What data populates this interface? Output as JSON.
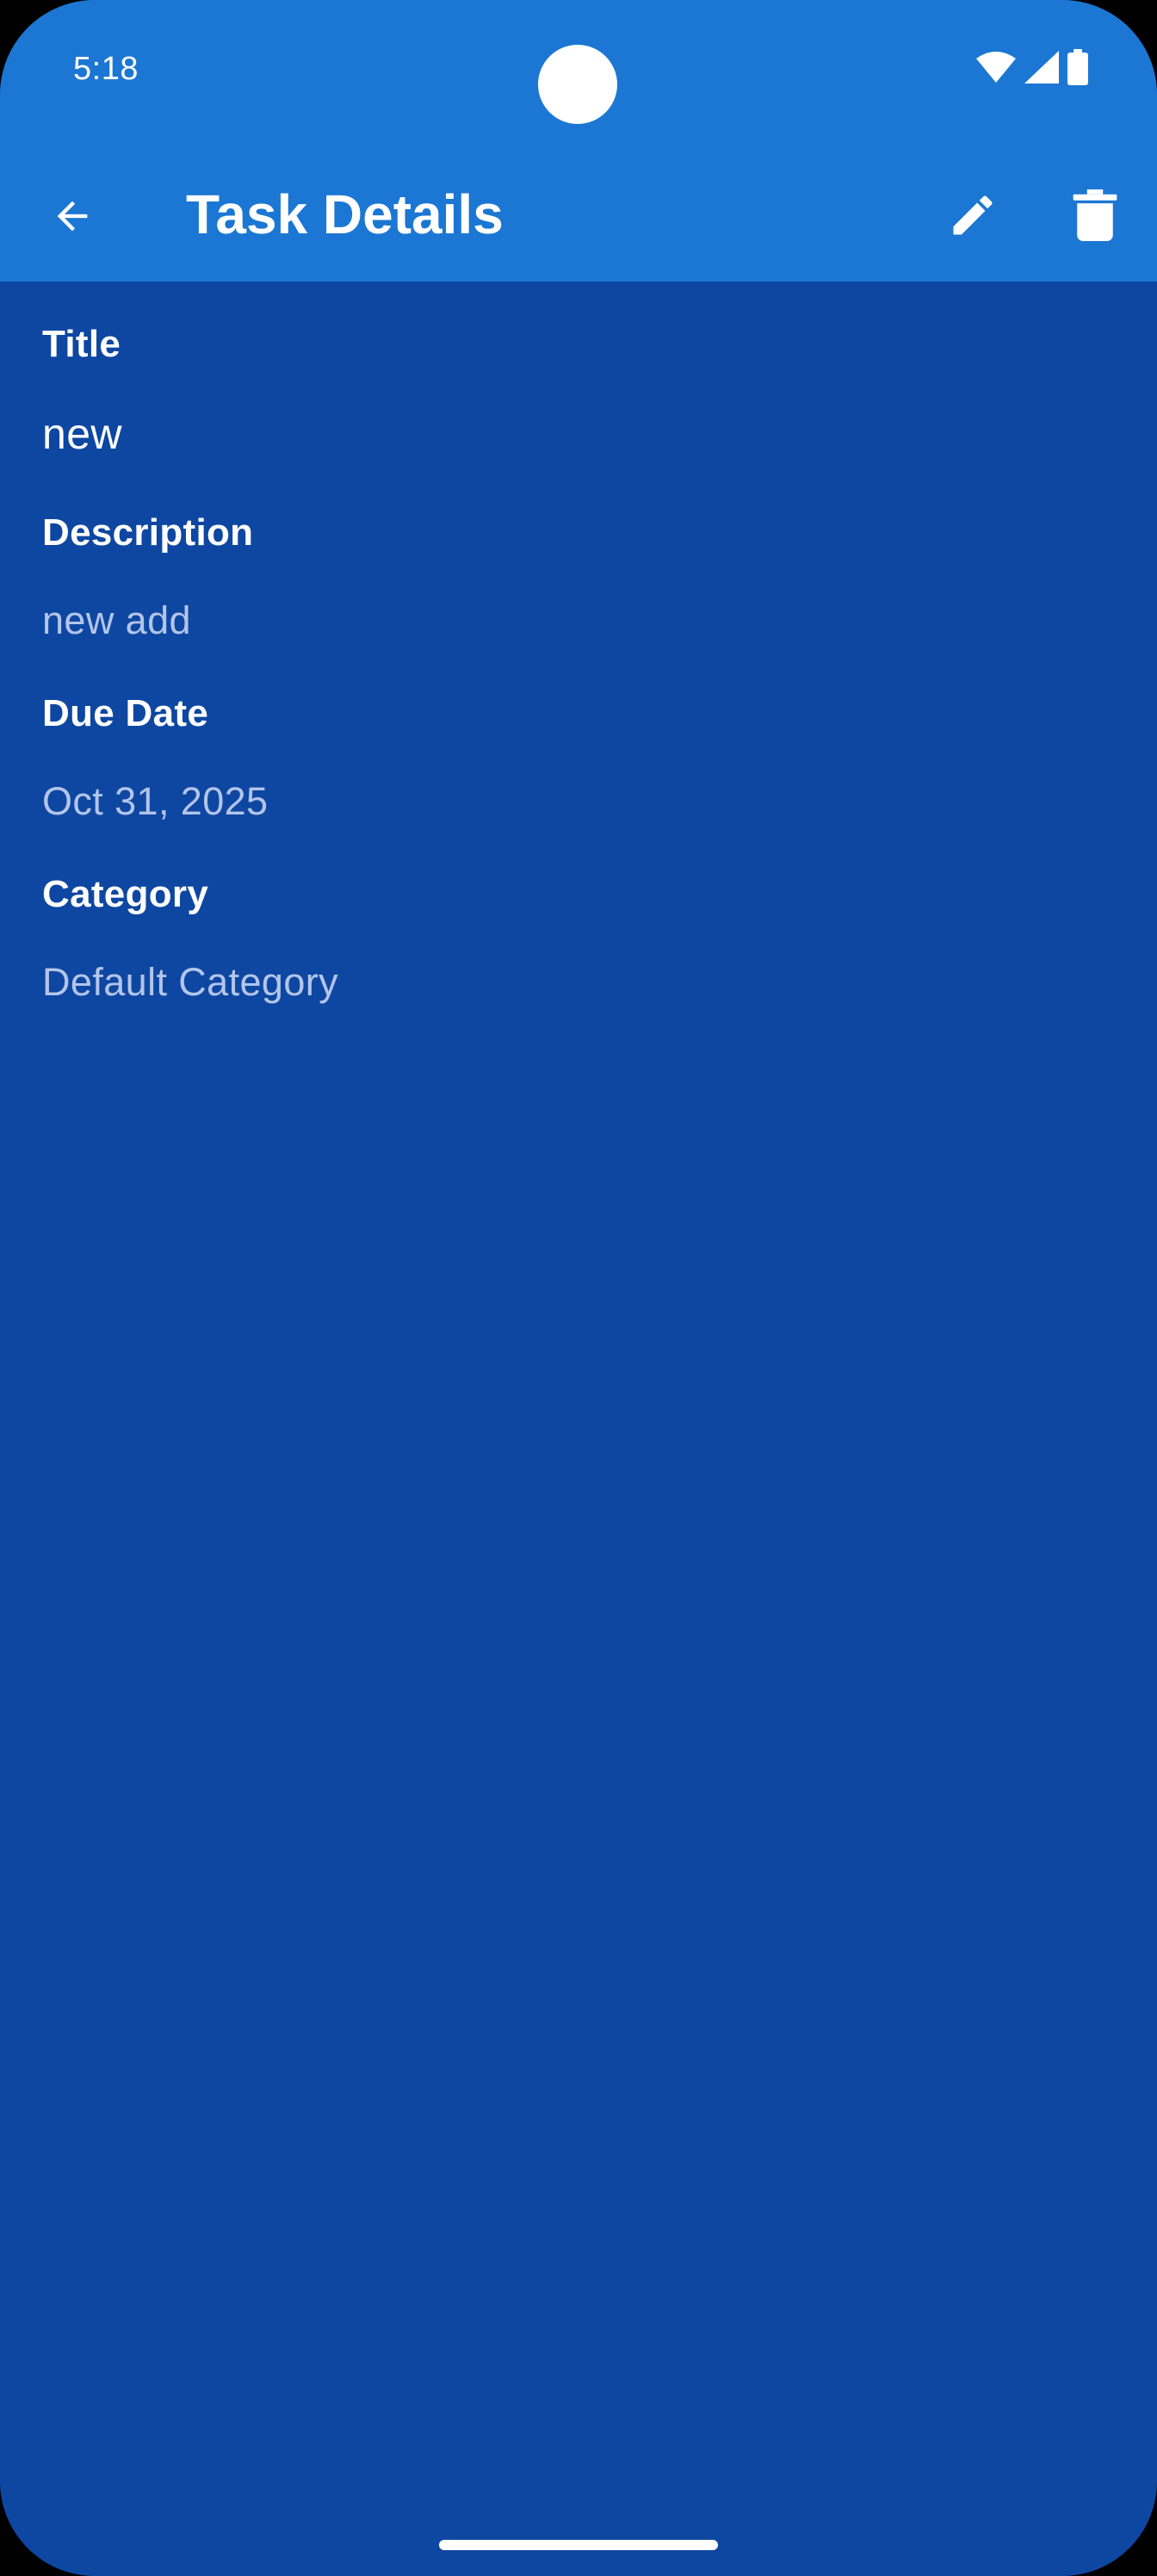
{
  "status_bar": {
    "time": "5:18",
    "icons": [
      "wifi-icon",
      "signal-icon",
      "battery-icon"
    ]
  },
  "app_bar": {
    "title": "Task Details",
    "back_icon": "arrow-back-icon",
    "edit_icon": "pencil-icon",
    "delete_icon": "trash-icon"
  },
  "task": {
    "fields": [
      {
        "label": "Title",
        "value": "new"
      },
      {
        "label": "Description",
        "value": "new add"
      },
      {
        "label": "Due Date",
        "value": "Oct 31, 2025"
      },
      {
        "label": "Category",
        "value": "Default Category"
      }
    ]
  },
  "colors": {
    "app_bar": "#1b77d3",
    "background": "#0e47a1",
    "label": "#ffffff",
    "secondary_text": "#b3c5ea"
  }
}
